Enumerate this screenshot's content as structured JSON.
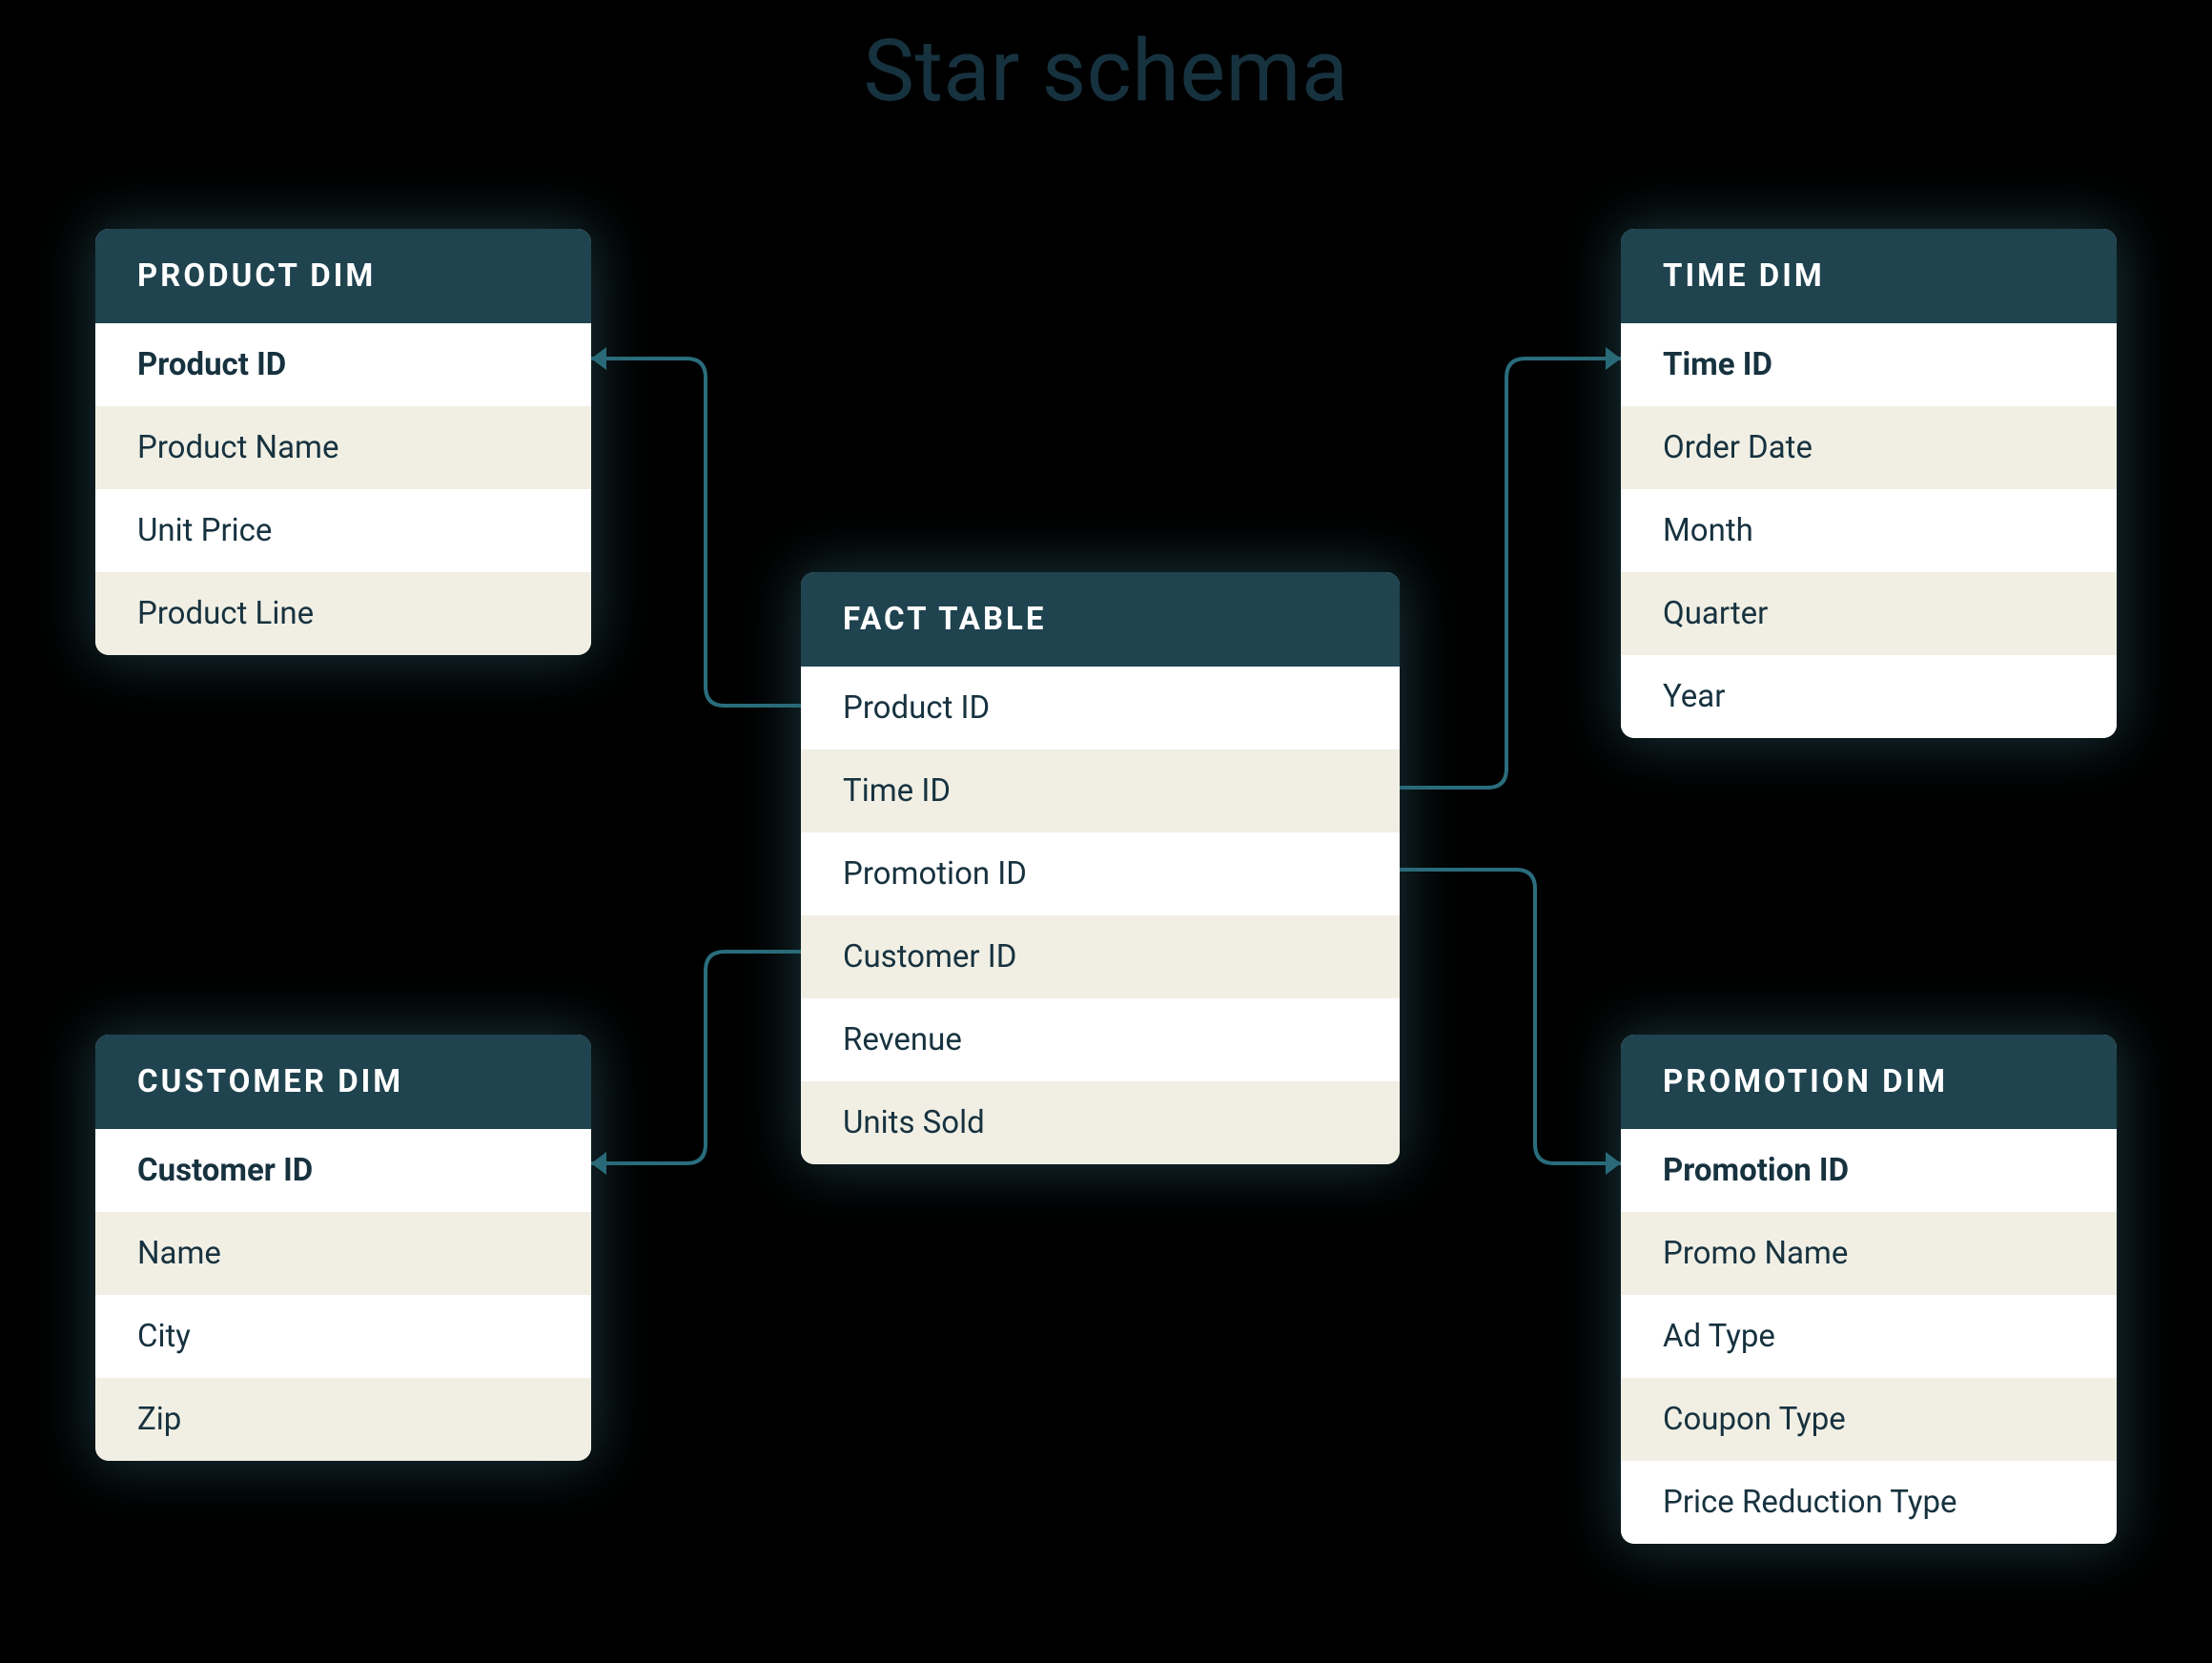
{
  "title": "Star schema",
  "colors": {
    "header_bg": "#1f434f",
    "header_text": "#ffffff",
    "row_bg": "#ffffff",
    "row_alt_bg": "#f1efe4",
    "text": "#17323f",
    "connector": "#2a6d7c",
    "page_bg": "#000000"
  },
  "tables": {
    "product": {
      "title": "PRODUCT DIM",
      "rows": [
        {
          "label": "Product ID",
          "bold": true
        },
        {
          "label": "Product Name"
        },
        {
          "label": "Unit Price"
        },
        {
          "label": "Product Line"
        }
      ]
    },
    "time": {
      "title": "TIME DIM",
      "rows": [
        {
          "label": "Time ID",
          "bold": true
        },
        {
          "label": "Order Date"
        },
        {
          "label": "Month"
        },
        {
          "label": "Quarter"
        },
        {
          "label": "Year"
        }
      ]
    },
    "customer": {
      "title": "CUSTOMER DIM",
      "rows": [
        {
          "label": "Customer ID",
          "bold": true
        },
        {
          "label": "Name"
        },
        {
          "label": "City"
        },
        {
          "label": "Zip"
        }
      ]
    },
    "promotion": {
      "title": "PROMOTION DIM",
      "rows": [
        {
          "label": "Promotion ID",
          "bold": true
        },
        {
          "label": "Promo Name"
        },
        {
          "label": "Ad Type"
        },
        {
          "label": "Coupon Type"
        },
        {
          "label": "Price Reduction Type"
        }
      ]
    },
    "fact": {
      "title": "FACT TABLE",
      "rows": [
        {
          "label": "Product ID"
        },
        {
          "label": "Time ID"
        },
        {
          "label": "Promotion ID"
        },
        {
          "label": "Customer ID"
        },
        {
          "label": "Revenue"
        },
        {
          "label": "Units Sold"
        }
      ]
    }
  },
  "connections": [
    {
      "from": "product.Product ID",
      "to": "fact.Product ID"
    },
    {
      "from": "time.Time ID",
      "to": "fact.Time ID"
    },
    {
      "from": "customer.Customer ID",
      "to": "fact.Customer ID"
    },
    {
      "from": "promotion.Promotion ID",
      "to": "fact.Promotion ID"
    }
  ]
}
